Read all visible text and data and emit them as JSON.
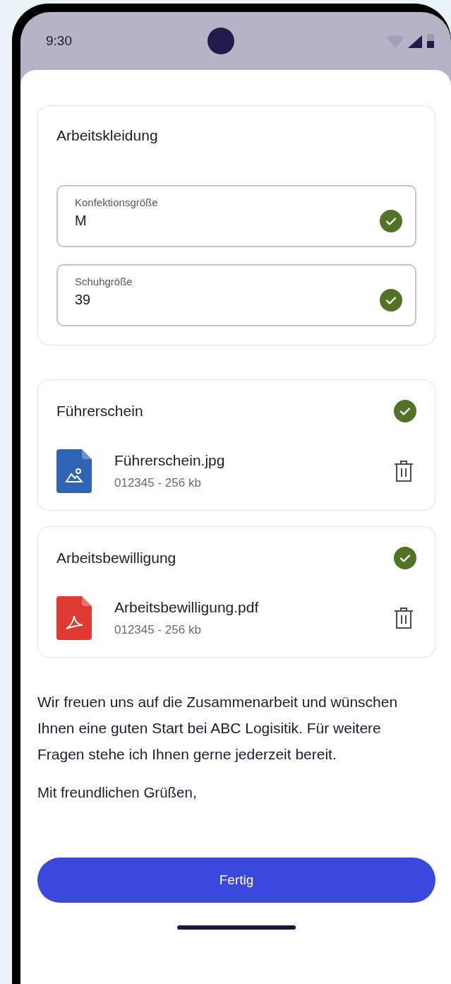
{
  "status_bar": {
    "time": "9:30"
  },
  "clothing_card": {
    "title": "Arbeitskleidung",
    "fields": [
      {
        "label": "Konfektionsgröße",
        "value": "M",
        "valid": true
      },
      {
        "label": "Schuhgröße",
        "value": "39",
        "valid": true
      }
    ]
  },
  "documents": [
    {
      "title": "Führerschein",
      "verified": true,
      "file": {
        "kind": "image",
        "name": "Führerschein.jpg",
        "meta": "012345 - 256 kb"
      }
    },
    {
      "title": "Arbeitsbewilligung",
      "verified": true,
      "file": {
        "kind": "pdf",
        "name": "Arbeitsbewilligung.pdf",
        "meta": "012345 - 256 kb"
      }
    }
  ],
  "message": "Wir freuen uns auf die Zusammenarbeit und wünschen Ihnen eine guten Start bei ABC Logisitik. Für weitere Fragen stehe ich Ihnen gerne jederzeit bereit.",
  "closing": "Mit freundlichen Grüßen,",
  "primary_button": "Fertig"
}
